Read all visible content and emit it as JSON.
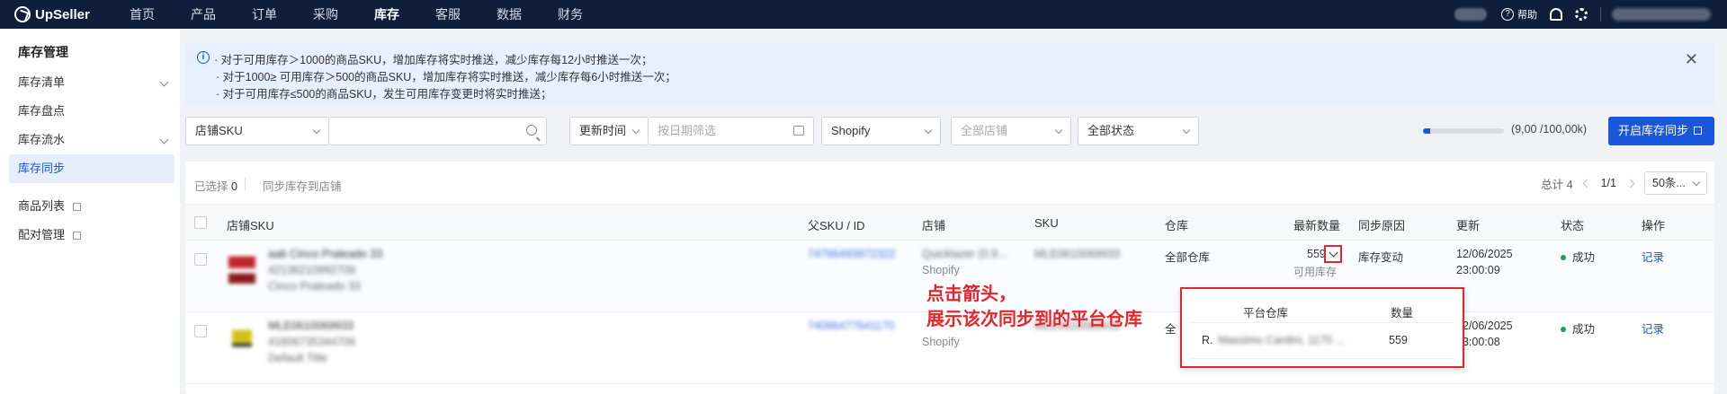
{
  "nav": {
    "brand": "UpSeller",
    "items": [
      "首页",
      "产品",
      "订单",
      "采购",
      "库存",
      "客服",
      "数据",
      "财务"
    ],
    "active_index": 4,
    "help": "帮助"
  },
  "sidebar": {
    "title": "库存管理",
    "items": [
      {
        "label": "库存清单"
      },
      {
        "label": "库存盘点"
      },
      {
        "label": "库存流水"
      },
      {
        "label": "库存同步"
      },
      {
        "label": "商品列表"
      },
      {
        "label": "配对管理"
      }
    ]
  },
  "notice": {
    "lines": [
      "· 对于可用库存＞1000的商品SKU，增加库存将实时推送，减少库存每12小时推送一次；",
      "· 对于1000≥ 可用库存＞500的商品SKU，增加库存将实时推送，减少库存每6小时推送一次；",
      "· 对于可用库存≤500的商品SKU，发生可用库存变更时将实时推送；"
    ]
  },
  "filters": {
    "sku_type": "店铺SKU",
    "search_placeholder": "",
    "time_type": "更新时间",
    "date_placeholder": "按日期筛选",
    "platform": "Shopify",
    "store_placeholder": "全部店铺",
    "status": "全部状态"
  },
  "quota": {
    "text": "(9,00 /100,00k)",
    "fraction": 0.09
  },
  "sync_button": "开启库存同步",
  "toolbar": {
    "selected_label": "已选择",
    "selected_count": "0",
    "sync_to_store": "同步库存到店铺"
  },
  "pager": {
    "total": "总计 4",
    "page": "1/1",
    "page_size": "50条..."
  },
  "columns": [
    "店铺SKU",
    "父SKU / ID",
    "店铺",
    "SKU",
    "仓库",
    "最新数量",
    "同步原因",
    "更新",
    "状态",
    "操作"
  ],
  "rows": [
    {
      "sku_title": "aab Cinco Praleado 33",
      "sku_id": "42136210992706",
      "sku_variant": "Cinco Praleado 33",
      "parent_sku": "74766493872322",
      "store": "Quicklazer (0.9...",
      "store_platform": "Shopify",
      "sku": "MLE0610069933",
      "warehouse": "全部仓库",
      "qty": "559",
      "qty_sub": "可用库存",
      "reason": "库存变动",
      "update_date": "12/06/2025",
      "update_time": "23:00:09",
      "status": "成功",
      "action": "记录"
    },
    {
      "sku_title": "MLE0610069933",
      "sku_id": "41806735344706",
      "sku_variant": "Default Title",
      "parent_sku": "74066477641170",
      "store": "",
      "store_platform": "Shopify",
      "sku": "MLE0610069933",
      "warehouse": "全",
      "qty": "",
      "qty_sub": "",
      "reason": "",
      "update_date": "12/06/2025",
      "update_time": "23:00:08",
      "status": "成功",
      "action": "记录"
    }
  ],
  "annotation": {
    "line1": "点击箭头，",
    "line2": "展示该次同步到的平台仓库"
  },
  "popup": {
    "col_warehouse": "平台仓库",
    "col_qty": "数量",
    "warehouse_prefix": "R.",
    "warehouse_name": "Massimo Cardini, 1170 ...",
    "qty": "559"
  },
  "colors": {
    "nav_bg": "#0f1e3a",
    "primary": "#1a56db",
    "annotation": "#e8242b",
    "success": "#22a04c"
  }
}
